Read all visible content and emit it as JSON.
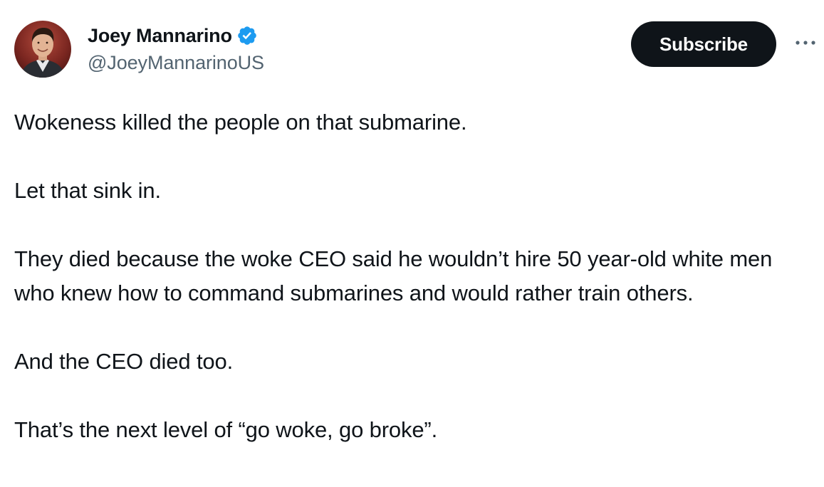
{
  "author": {
    "display_name": "Joey Mannarino",
    "handle": "@JoeyMannarinoUS",
    "verified": true,
    "verified_color": "#1d9bf0",
    "avatar_icon": "profile-photo"
  },
  "actions": {
    "subscribe_label": "Subscribe",
    "more_icon": "ellipsis-icon"
  },
  "tweet": {
    "paragraphs": [
      "Wokeness killed the people on that submarine.",
      "Let that sink in.",
      "They died because the woke CEO said he wouldn’t hire 50 year-old white men who knew how to command submarines and would rather train others.",
      "And the CEO died too.",
      "That’s the next level of “go woke, go broke”."
    ]
  },
  "colors": {
    "text_primary": "#0f1419",
    "text_secondary": "#536471",
    "button_bg": "#0f1419",
    "button_text": "#ffffff"
  }
}
